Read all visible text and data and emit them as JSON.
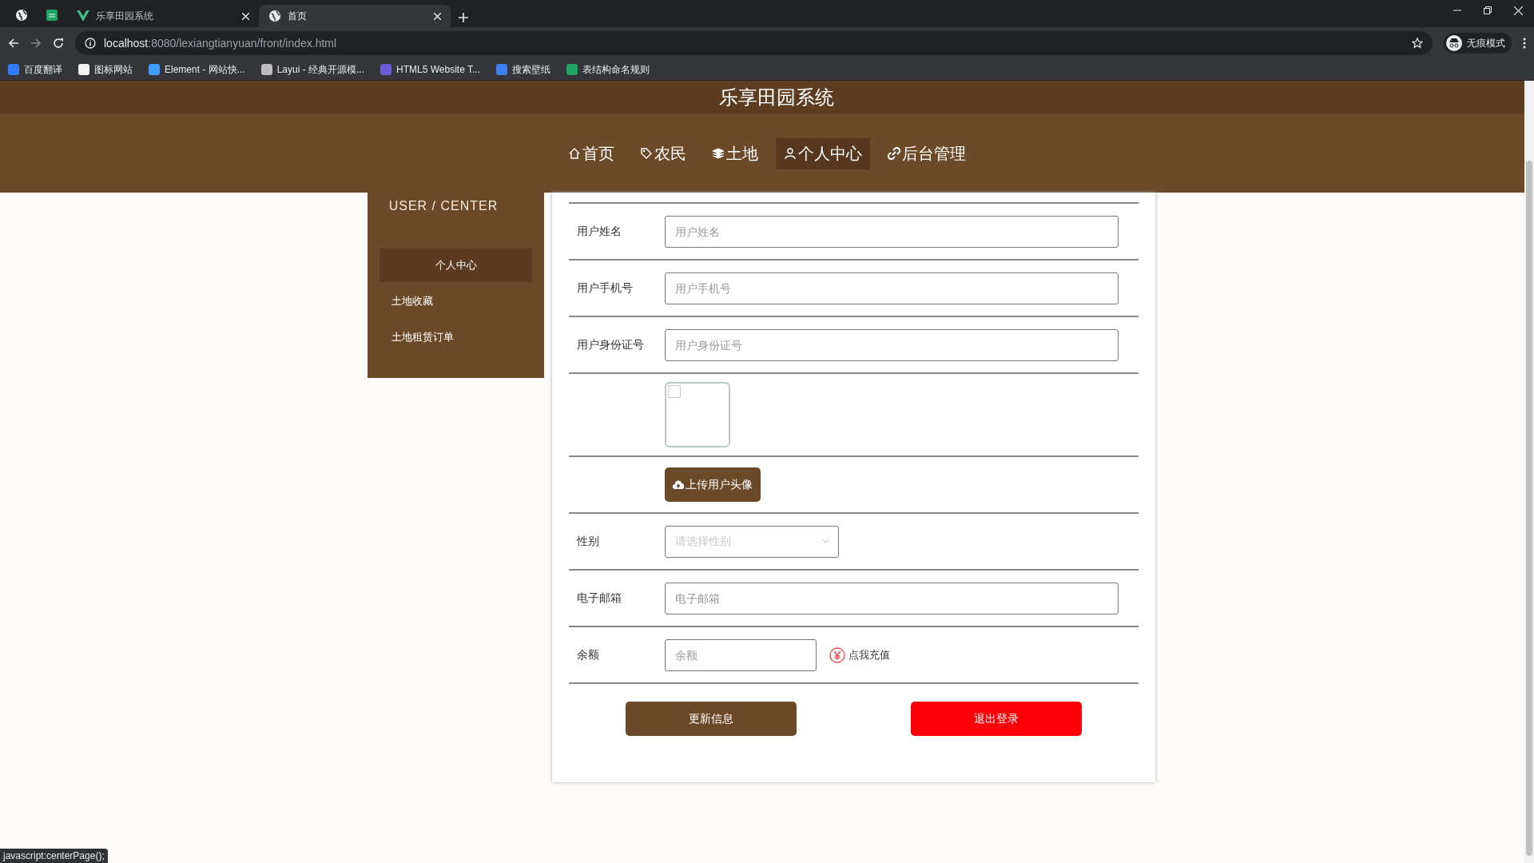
{
  "browser": {
    "tabs": [
      {
        "title": "乐享田园系统",
        "selected": false
      },
      {
        "title": "首页",
        "selected": true
      }
    ],
    "address": {
      "host": "localhost",
      "path": ":8080/lexiangtianyuan/front/index.html"
    },
    "profile": "无痕模式",
    "bookmarks": [
      {
        "label": "百度翻译",
        "color": "#2f7cf6"
      },
      {
        "label": "图标网站",
        "color": "#f2f2f2"
      },
      {
        "label": "Element - 网站快...",
        "color": "#409eff"
      },
      {
        "label": "Layui - 经典开源模...",
        "color": "#bdbdbd"
      },
      {
        "label": "HTML5 Website T...",
        "color": "#6b5bd6"
      },
      {
        "label": "搜索壁纸",
        "color": "#3d7ef0"
      },
      {
        "label": "表结构命名规则",
        "color": "#1fa463"
      }
    ]
  },
  "site_title": "乐享田园系统",
  "nav": [
    {
      "label": "首页",
      "selected": false
    },
    {
      "label": "农民",
      "selected": false
    },
    {
      "label": "土地",
      "selected": false
    },
    {
      "label": "个人中心",
      "selected": true
    },
    {
      "label": "后台管理",
      "selected": false
    }
  ],
  "sidebar": {
    "heading": "USER / CENTER",
    "items": [
      {
        "label": "个人中心",
        "selected": true
      },
      {
        "label": "土地收藏",
        "selected": false
      },
      {
        "label": "土地租赁订单",
        "selected": false
      }
    ]
  },
  "form": {
    "fields": [
      {
        "kind": "text",
        "label": "用户姓名",
        "placeholder": "用户姓名"
      },
      {
        "kind": "text",
        "label": "用户手机号",
        "placeholder": "用户手机号"
      },
      {
        "kind": "text",
        "label": "用户身份证号",
        "placeholder": "用户身份证号"
      },
      {
        "kind": "avatar"
      },
      {
        "kind": "upload",
        "button": "上传用户头像"
      },
      {
        "kind": "select",
        "label": "性别",
        "placeholder": "请选择性别"
      },
      {
        "kind": "text",
        "label": "电子邮箱",
        "placeholder": "电子邮箱"
      },
      {
        "kind": "balance",
        "label": "余额",
        "placeholder": "余额",
        "link": "点我充值"
      }
    ],
    "buttons": [
      {
        "label": "更新信息",
        "kind": "primary"
      },
      {
        "label": "退出登录",
        "kind": "danger"
      }
    ]
  },
  "status_bar": "javascript:centerPage();"
}
